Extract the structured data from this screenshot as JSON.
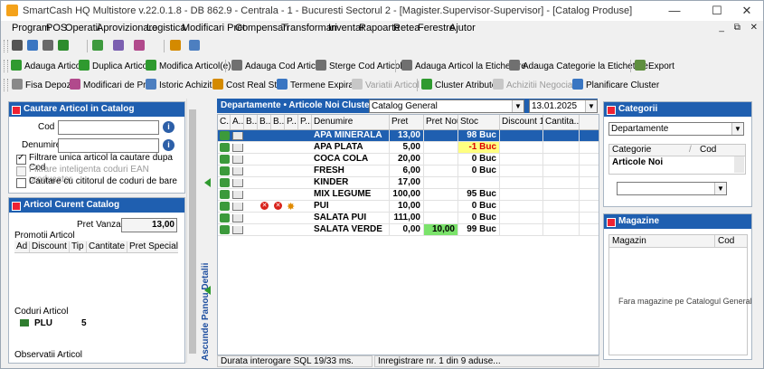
{
  "window": {
    "title": "SmartCash HQ Multistore v.22.0.1.8 - DB 862.9 - Centrala - 1 - Bucuresti Sectorul 2 - [Magister.Supervisor-Supervisor] - [Catalog Produse]",
    "minimize": "—",
    "maximize": "☐",
    "close": "✕"
  },
  "menu": [
    "Program",
    "POS",
    "Operatii",
    "Aprovizionare",
    "Logistica",
    "Modificari Pret",
    "Compensari",
    "Transformari",
    "Inventar",
    "Rapoarte",
    "Retea",
    "Ferestre",
    "Ajutor"
  ],
  "mdi": {
    "minimize": "_",
    "restore": "⧉",
    "close": "✕"
  },
  "toolbar2": {
    "add": "Adauga Articol",
    "dup": "Duplica Articol",
    "mod": "Modifica Articol(e)",
    "addcod": "Adauga Cod Articol",
    "delcod": "Sterge Cod Articol",
    "addlabel": "Adauga Articol la Etichetare",
    "addcat": "Adauga Categorie la Etichetare",
    "export": "Export"
  },
  "toolbar3": {
    "fisa": "Fisa Depozit",
    "modpret": "Modificari de Pret",
    "istoric": "Istoric Achizitii",
    "cost": "Cost Real Stoc",
    "term": "Termene Expirare",
    "var": "Variatii Articol",
    "clatr": "Cluster Atribute",
    "achneg": "Achizitii Negociate",
    "planif": "Planificare Cluster"
  },
  "search": {
    "title": "Cautare Articol in Catalog",
    "cod_label": "Cod",
    "denumire_label": "Denumire",
    "cb1": "Filtrare unica articol la cautare dupa Cod",
    "cb2": "Filtrare inteligenta coduri EAN producator",
    "cb3": "Cautare cu cititorul de coduri de bare",
    "info": "i"
  },
  "current": {
    "title": "Articol Curent Catalog",
    "pret_label": "Pret Vanzare",
    "pret_value": "13,00",
    "promo_label": "Promotii Articol",
    "promo_cols": [
      "Ad",
      "Discount",
      "Tip",
      "Cantitate",
      "Pret Special"
    ],
    "coduri_label": "Coduri Articol",
    "cod_type": "PLU",
    "cod_value": "5",
    "obs_label": "Observatii Articol"
  },
  "splitter": {
    "label": "Ascunde Panou Detalii"
  },
  "main": {
    "header": "Departamente • Articole Noi",
    "cluster_label": "Cluster",
    "cluster_value": "Catalog General",
    "date": "13.01.2025",
    "columns": [
      "C...",
      "A...",
      "B...",
      "B...",
      "B...",
      "P...",
      "P...",
      "Denumire",
      "Pret",
      "Pret Nou",
      "Stoc",
      "Discount 1",
      "Cantita..."
    ],
    "rows": [
      {
        "name": "APA MINERALA",
        "pret": "13,00",
        "nou": "",
        "stoc": "98 Buc",
        "selected": true
      },
      {
        "name": "APA PLATA",
        "pret": "5,00",
        "nou": "",
        "stoc": "-1 Buc",
        "warn": true
      },
      {
        "name": "COCA COLA",
        "pret": "20,00",
        "nou": "",
        "stoc": "0 Buc"
      },
      {
        "name": "FRESH",
        "pret": "6,00",
        "nou": "",
        "stoc": "0 Buc"
      },
      {
        "name": "KINDER",
        "pret": "17,00",
        "nou": "",
        "stoc": ""
      },
      {
        "name": "MIX LEGUME",
        "pret": "100,00",
        "nou": "",
        "stoc": "95 Buc"
      },
      {
        "name": "PUI",
        "pret": "10,00",
        "nou": "",
        "stoc": "0 Buc",
        "flags": true
      },
      {
        "name": "SALATA PUI",
        "pret": "111,00",
        "nou": "",
        "stoc": "0 Buc"
      },
      {
        "name": "SALATA VERDE",
        "pret": "0,00",
        "nou": "10,00",
        "stoc": "99 Buc"
      }
    ]
  },
  "categorii": {
    "title": "Categorii",
    "select": "Departamente",
    "col1": "Categorie",
    "col2": "Cod",
    "item": "Articole Noi"
  },
  "magazine": {
    "title": "Magazine",
    "col1": "Magazin",
    "col2": "Cod",
    "empty": "Fara magazine pe Catalogul General"
  },
  "status": {
    "sql": "Durata interogare SQL 19/33 ms.",
    "rec": "Inregistrare nr. 1 din 9 aduse..."
  },
  "colors": {
    "accent": "#1f5fb0",
    "warn": "#ffff80",
    "green": "#7be36b"
  }
}
